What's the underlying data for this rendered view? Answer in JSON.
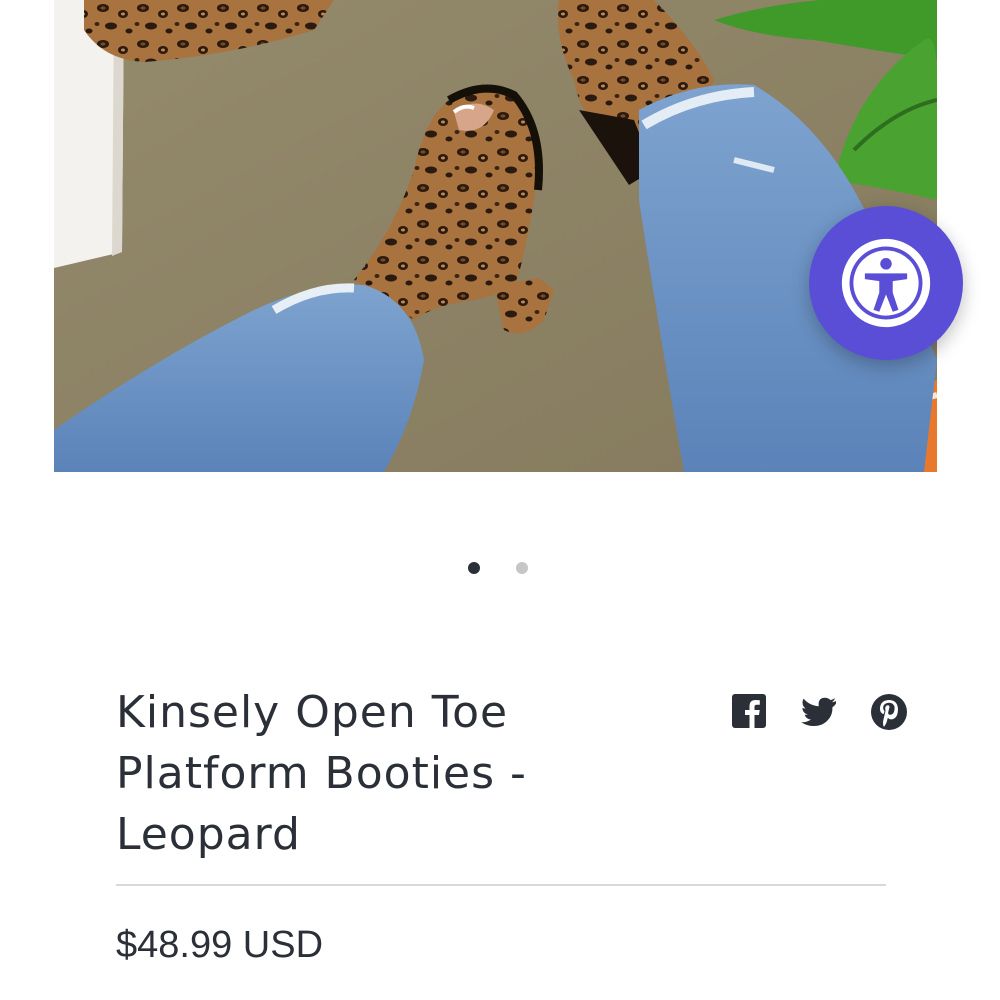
{
  "product": {
    "image_alt": "Leopard print open toe platform booties worn with distressed jeans",
    "title_lines": [
      "Kinsely Open Toe",
      "Platform Booties -",
      "Leopard"
    ],
    "price": "$48.99 USD"
  },
  "carousel": {
    "total_slides": 2,
    "active_slide": 1
  },
  "share": {
    "icons": [
      "facebook-icon",
      "twitter-icon",
      "pinterest-icon"
    ]
  },
  "accessibility": {
    "icon": "accessibility-icon",
    "color": "#5b4ed6"
  },
  "colors": {
    "text": "#2b2f38",
    "dot_active": "#2b2f38",
    "dot_inactive": "#c6c6c6",
    "divider": "#d9d9d9"
  }
}
